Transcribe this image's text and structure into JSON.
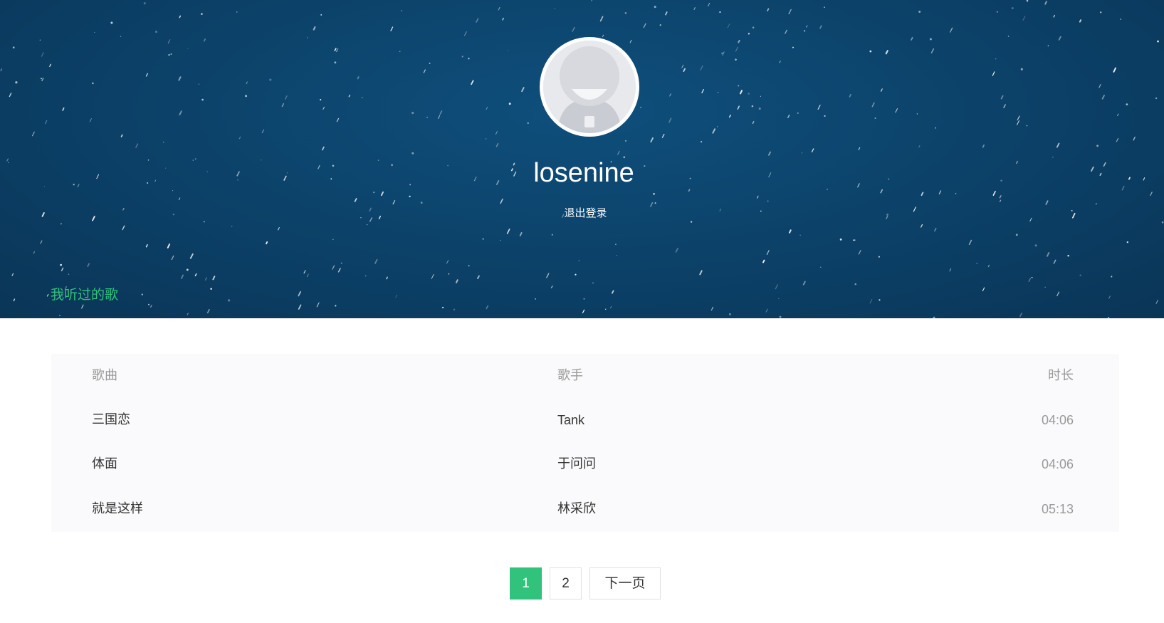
{
  "profile": {
    "username": "losenine",
    "logout_label": "退出登录"
  },
  "tabs": {
    "history_label": "我听过的歌"
  },
  "table": {
    "headers": {
      "song": "歌曲",
      "singer": "歌手",
      "duration": "时长"
    },
    "rows": [
      {
        "song": "三国恋",
        "singer": "Tank",
        "duration": "04:06"
      },
      {
        "song": "体面",
        "singer": "于问问",
        "duration": "04:06"
      },
      {
        "song": "就是这样",
        "singer": "林采欣",
        "duration": "05:13"
      }
    ]
  },
  "pagination": {
    "pages": [
      "1",
      "2"
    ],
    "current": "1",
    "next_label": "下一页"
  },
  "colors": {
    "accent": "#31c27c",
    "banner": "#0c436b"
  }
}
